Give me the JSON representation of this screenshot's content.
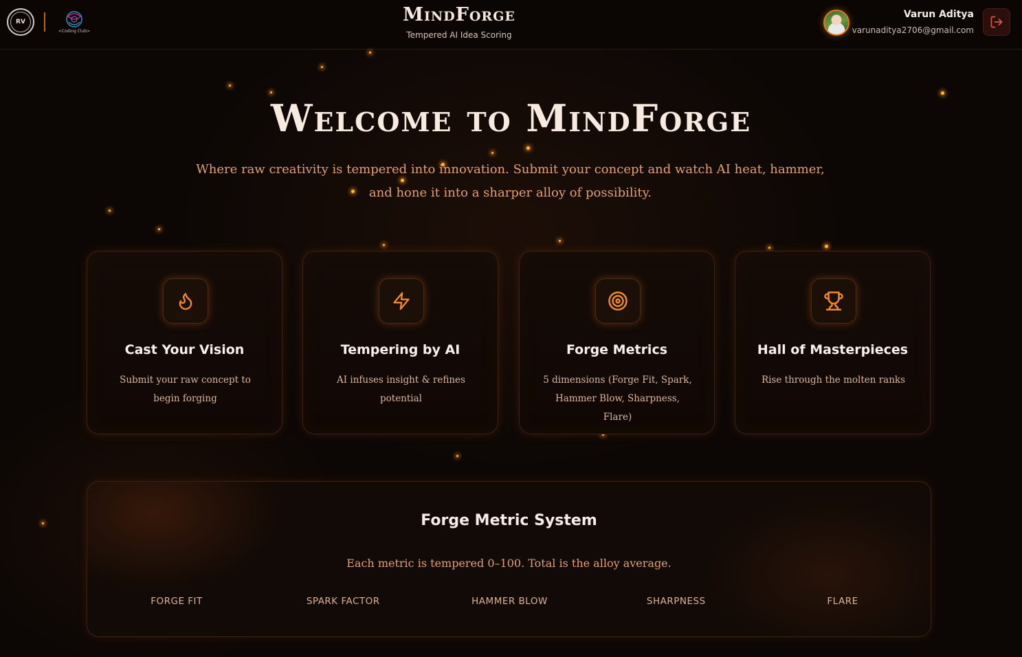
{
  "header": {
    "university_logo_text": "RV",
    "club_logo_text": "<Coding Club>",
    "title": "MindForge",
    "subtitle": "Tempered AI Idea Scoring",
    "user": {
      "name": "Varun Aditya",
      "email": "varunaditya2706@gmail.com"
    },
    "icons": {
      "logout": "logout-icon",
      "avatar": "user-avatar"
    }
  },
  "hero": {
    "title": "Welcome to MindForge",
    "description": "Where raw creativity is tempered into innovation. Submit your concept and watch AI heat, hammer, and hone it into a sharper alloy of possibility."
  },
  "cards": [
    {
      "icon": "flame-icon",
      "title": "Cast Your Vision",
      "description": "Submit your raw concept to begin forging"
    },
    {
      "icon": "lightning-icon",
      "title": "Tempering by AI",
      "description": "AI infuses insight & refines potential"
    },
    {
      "icon": "target-icon",
      "title": "Forge Metrics",
      "description": "5 dimensions (Forge Fit, Spark, Hammer Blow, Sharpness, Flare)"
    },
    {
      "icon": "trophy-icon",
      "title": "Hall of Masterpieces",
      "description": "Rise through the molten ranks"
    }
  ],
  "metric_system": {
    "title": "Forge Metric System",
    "subtitle": "Each metric is tempered 0–100. Total is the alloy average.",
    "metrics": [
      "Forge Fit",
      "Spark Factor",
      "Hammer Blow",
      "Sharpness",
      "Flare"
    ]
  },
  "colors": {
    "accent": "#e07a22",
    "ember": "#ffb43a",
    "background": "#0c0705",
    "description_text": "#e3a173"
  }
}
